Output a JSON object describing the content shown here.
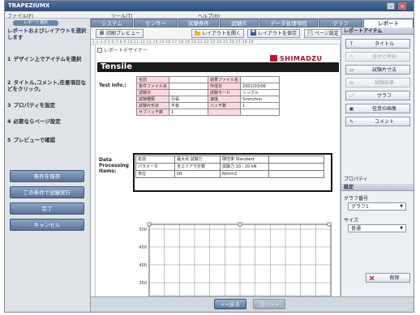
{
  "window": {
    "title": "TRAPEZIUMX"
  },
  "menubar": {
    "items": [
      "ファイル(F)",
      "ツール(T)",
      "ヘルプ(H)"
    ]
  },
  "tabs": [
    "システム",
    "センサー",
    "試験条件",
    "試験片",
    "データ処理項目",
    "グラフ",
    "レポート"
  ],
  "left": {
    "pill": "レポート選択",
    "steps": [
      {
        "num": "",
        "text": "レポートおよびレイアウトを選択します"
      },
      {
        "num": "1",
        "text": "デザイン上でアイテムを選択"
      },
      {
        "num": "2",
        "text": "タイトル,コメント,任意項目などをクリック。"
      },
      {
        "num": "3",
        "text": "プロパティを設定"
      },
      {
        "num": "4",
        "text": "必要ならページ設定"
      },
      {
        "num": "5",
        "text": "プレビューで確認"
      }
    ],
    "buttons": [
      "条件を保存",
      "この条件で試験実行",
      "完了",
      "キャンセル"
    ]
  },
  "toolbar": {
    "preview": "印刷プレビュー",
    "open_layout": "レイアウトを開く",
    "save_layout": "レイアウトを保存",
    "page_setup": "ページ設定"
  },
  "ruler_text": "-1·2·3·4·5·6·7·8·9·10·11·12·13·14·15·16·17·18·19·20·21·22·23·24·25·26·27·28·29",
  "designer": {
    "label": "レポートデザイナー",
    "logo": "SHIMADZU",
    "report_title": "Tensile",
    "test_info_label": "Test Info.:",
    "info_rows": [
      [
        "名前",
        "",
        "結果ファイル名",
        ""
      ],
      [
        "条件ファイル名",
        "",
        "作成日",
        "2001/03/06"
      ],
      [
        "試験日",
        "",
        "試験モード",
        "シングル"
      ],
      [
        "試験種類",
        "引張",
        "速度",
        "5mm/min"
      ],
      [
        "試験片形状",
        "平板",
        "バッチ数",
        "1"
      ],
      [
        "サブバッチ数",
        "1",
        "",
        ""
      ]
    ],
    "proc_label": "Data Processing Items:",
    "proc_rows": [
      [
        "名前",
        "最大点 試験力",
        "弾性率 Standard",
        ""
      ],
      [
        "パラメータ",
        "全エリアで計算",
        "試験力 10 - 20 kN",
        ""
      ],
      [
        "単位",
        "kN",
        "N/mm2",
        ""
      ]
    ],
    "graph": {
      "y_ticks": [
        "500",
        "450",
        "400",
        "350"
      ]
    }
  },
  "bottom": {
    "prev": "<<戻る",
    "next": "次へ>>"
  },
  "right": {
    "header_items": "レポートアイテム",
    "items": [
      {
        "label": "タイトル",
        "icon": "title-icon",
        "enabled": true
      },
      {
        "label": "日付と時刻",
        "icon": "clock-icon",
        "enabled": false
      },
      {
        "label": "試験片寸法",
        "icon": "specimen-icon",
        "enabled": true
      },
      {
        "label": "試験結果",
        "icon": "results-icon",
        "enabled": false
      },
      {
        "label": "グラフ",
        "icon": "graph-icon",
        "enabled": true
      },
      {
        "label": "任意の画像",
        "icon": "image-icon",
        "enabled": true
      },
      {
        "label": "コメント",
        "icon": "comment-icon",
        "enabled": true
      }
    ],
    "header_props": "プロパティ",
    "header_settings": "設定",
    "graph_no_label": "グラフ番号",
    "graph_no_value": "グラフ1",
    "size_label": "サイズ",
    "size_value": "普通",
    "delete_label": "削除"
  },
  "colors": {
    "accent": "#2b4570",
    "logo_red": "#c8102e",
    "key_cell": "#ffd9e0"
  }
}
